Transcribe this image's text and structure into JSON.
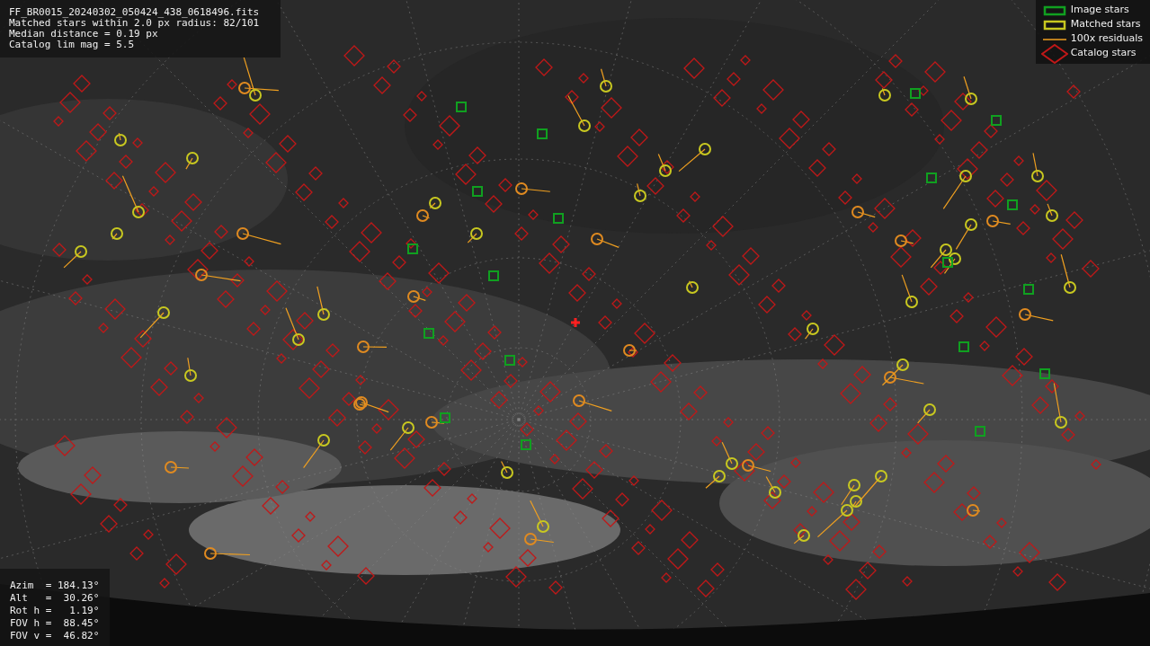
{
  "info_lines": [
    "FF_BR0015_20240302_050424_438_0618496.fits",
    "Matched stars within 2.0 px radius: 82/101",
    "Median distance = 0.19 px",
    "Catalog lim mag = 5.5"
  ],
  "legend": [
    {
      "label": "Image stars"
    },
    {
      "kind": "matched",
      "label": "Matched stars"
    },
    {
      "kind": "residual",
      "label": "100x residuals"
    },
    {
      "kind": "catalog",
      "label": "Catalog stars"
    }
  ],
  "pointing": [
    "Azim  = 184.13°",
    "Alt   =  30.26°",
    "Rot h =   1.19°",
    "FOV h =  88.45°",
    "FOV v =  46.82°"
  ]
}
